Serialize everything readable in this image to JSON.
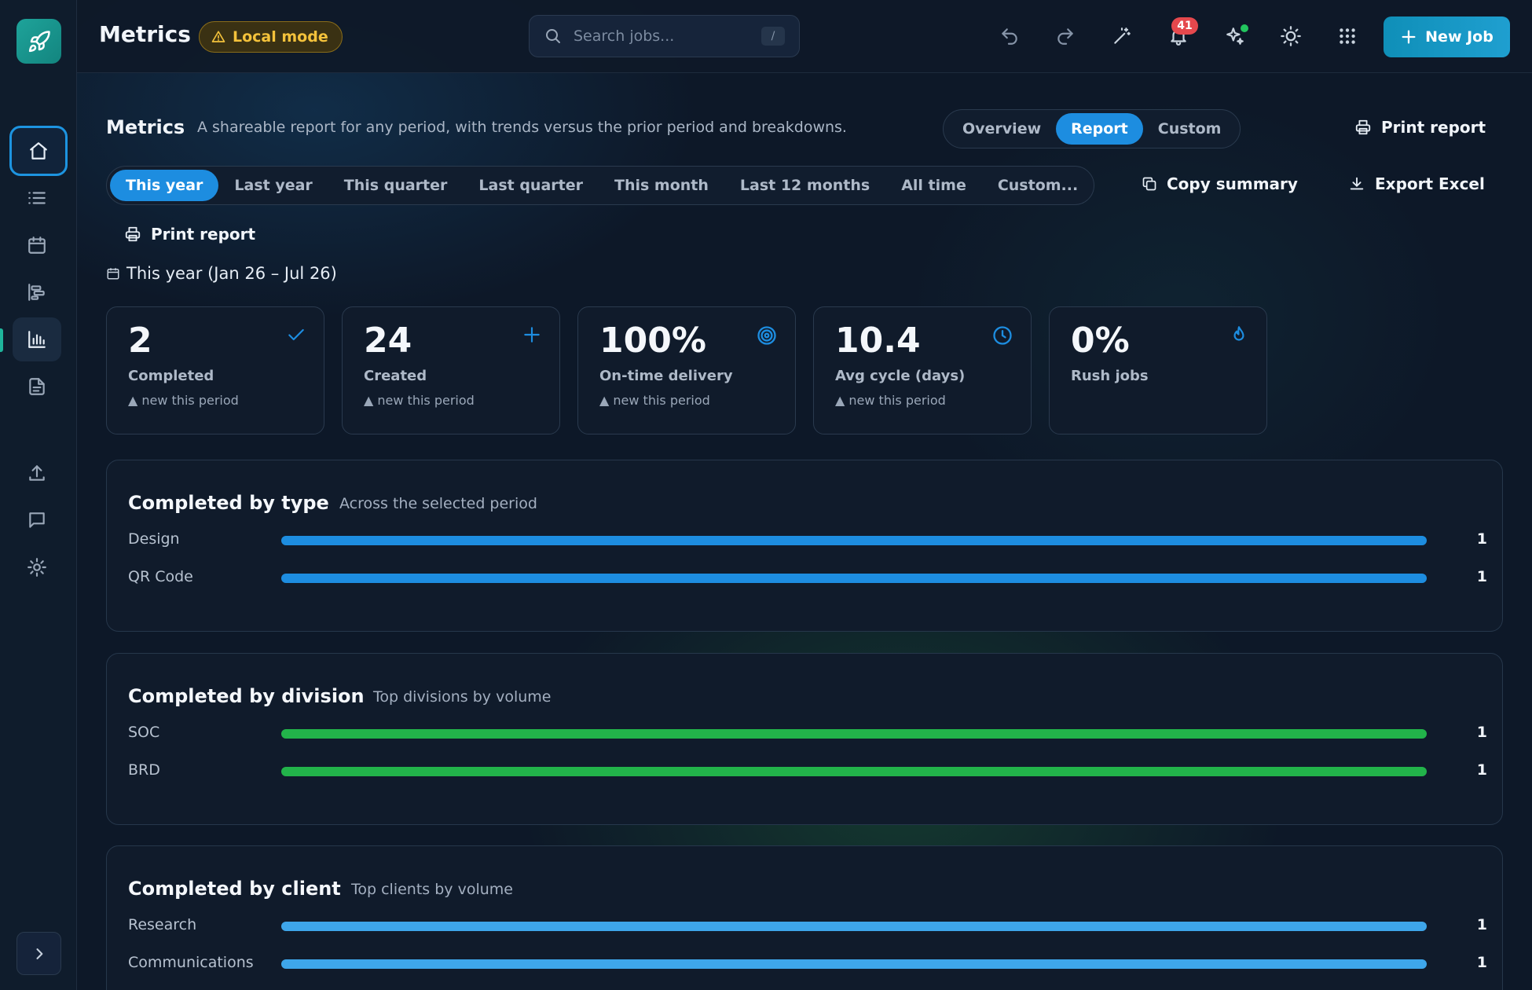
{
  "topbar": {
    "title": "Metrics",
    "mode_badge": "Local mode",
    "search_placeholder": "Search jobs...",
    "search_shortcut": "/",
    "notifications_count": "41",
    "new_job_label": "New Job"
  },
  "header": {
    "title": "Metrics",
    "subtitle": "A shareable report for any period, with trends versus the prior period and breakdowns.",
    "views": [
      "Overview",
      "Report",
      "Custom"
    ],
    "active_view": "Report",
    "print_report": "Print report",
    "copy_summary": "Copy summary",
    "export_excel": "Export Excel",
    "print_report_2": "Print report"
  },
  "periods": {
    "items": [
      "This year",
      "Last year",
      "This quarter",
      "Last quarter",
      "This month",
      "Last 12 months",
      "All time",
      "Custom..."
    ],
    "active": "This year"
  },
  "range_label": "This year (Jan 26 – Jul 26)",
  "kpis": [
    {
      "value": "2",
      "label": "Completed",
      "note": "▲ new this period",
      "icon": "check-icon"
    },
    {
      "value": "24",
      "label": "Created",
      "note": "▲ new this period",
      "icon": "plus-icon"
    },
    {
      "value": "100%",
      "label": "On-time delivery",
      "note": "▲ new this period",
      "icon": "target-icon"
    },
    {
      "value": "10.4",
      "label": "Avg cycle (days)",
      "note": "▲ new this period",
      "icon": "clock-icon"
    },
    {
      "value": "0%",
      "label": "Rush jobs",
      "note": "",
      "icon": "flame-icon"
    }
  ],
  "panels": {
    "by_type": {
      "title": "Completed by type",
      "subtitle": "Across the selected period",
      "color": "#1d8de0",
      "rows": [
        {
          "label": "Design",
          "value": "1",
          "fraction": 1.0
        },
        {
          "label": "QR Code",
          "value": "1",
          "fraction": 1.0
        }
      ]
    },
    "by_division": {
      "title": "Completed by division",
      "subtitle": "Top divisions by volume",
      "color": "#22b34a",
      "rows": [
        {
          "label": "SOC",
          "value": "1",
          "fraction": 1.0
        },
        {
          "label": "BRD",
          "value": "1",
          "fraction": 1.0
        }
      ]
    },
    "by_client": {
      "title": "Completed by client",
      "subtitle": "Top clients by volume",
      "color": "#3ea6ea",
      "rows": [
        {
          "label": "Research",
          "value": "1",
          "fraction": 1.0
        },
        {
          "label": "Communications",
          "value": "1",
          "fraction": 1.0
        }
      ]
    }
  },
  "colors": {
    "accent": "#1d8de0",
    "warning": "#f4c23b",
    "danger": "#e5484d",
    "success": "#22c55e"
  }
}
